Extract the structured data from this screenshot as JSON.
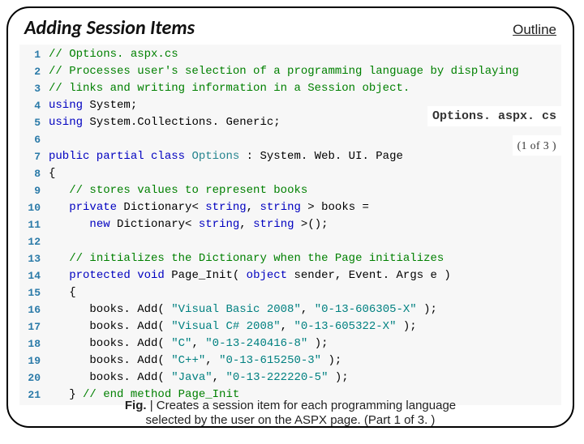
{
  "header": {
    "title": "Adding Session Items",
    "outline_link": "Outline"
  },
  "floating": {
    "filename": "Options. aspx. cs",
    "page_info": "(1 of 3 )"
  },
  "code": {
    "lines": [
      {
        "n": 1,
        "html": "<span class='cmt'>// Options. aspx.cs</span>"
      },
      {
        "n": 2,
        "html": "<span class='cmt'>// Processes user's selection of a programming language by displaying</span>"
      },
      {
        "n": 3,
        "html": "<span class='cmt'>// links and writing information in a Session object.</span>"
      },
      {
        "n": 4,
        "html": "<span class='kw'>using</span> System;"
      },
      {
        "n": 5,
        "html": "<span class='kw'>using</span> System.Collections. Generic;"
      },
      {
        "n": 6,
        "html": ""
      },
      {
        "n": 7,
        "html": "<span class='kw'>public partial class</span> <span class='cls'>Options</span> : System. Web. UI. Page"
      },
      {
        "n": 8,
        "html": "{"
      },
      {
        "n": 9,
        "html": "   <span class='cmt'>// stores values to represent books</span>"
      },
      {
        "n": 10,
        "html": "   <span class='kw'>private</span> Dictionary&lt; <span class='kw'>string</span>, <span class='kw'>string</span> &gt; books ="
      },
      {
        "n": 11,
        "html": "      <span class='kw'>new</span> Dictionary&lt; <span class='kw'>string</span>, <span class='kw'>string</span> &gt;();"
      },
      {
        "n": 12,
        "html": ""
      },
      {
        "n": 13,
        "html": "   <span class='cmt'>// initializes the Dictionary when the Page initializes</span>"
      },
      {
        "n": 14,
        "html": "   <span class='kw'>protected void</span> Page_Init( <span class='kw'>object</span> sender, Event. Args e )"
      },
      {
        "n": 15,
        "html": "   {"
      },
      {
        "n": 16,
        "html": "      books. Add( <span class='str'>\"Visual Basic 2008\"</span>, <span class='str'>\"0-13-606305-X\"</span> );"
      },
      {
        "n": 17,
        "html": "      books. Add( <span class='str'>\"Visual C# 2008\"</span>, <span class='str'>\"0-13-605322-X\"</span> );"
      },
      {
        "n": 18,
        "html": "      books. Add( <span class='str'>\"C\"</span>, <span class='str'>\"0-13-240416-8\"</span> );"
      },
      {
        "n": 19,
        "html": "      books. Add( <span class='str'>\"C++\"</span>, <span class='str'>\"0-13-615250-3\"</span> );"
      },
      {
        "n": 20,
        "html": "      books. Add( <span class='str'>\"Java\"</span>, <span class='str'>\"0-13-222220-5\"</span> );"
      },
      {
        "n": 21,
        "html": "   } <span class='cmt'>// end method Page_Init</span>"
      }
    ]
  },
  "caption": {
    "fig_label": "Fig.",
    "sep": " | ",
    "text1": "Creates a session item for each programming language",
    "text2": "selected by the user on the ASPX page. (Part 1 of 3. )"
  }
}
